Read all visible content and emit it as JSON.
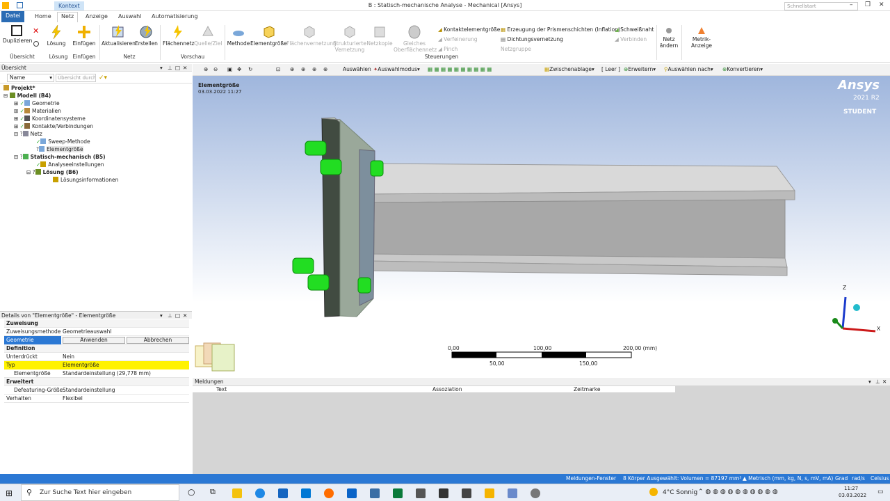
{
  "title_bar": {
    "context_tab": "Kontext",
    "window_title": "B : Statisch-mechanische Analyse - Mechanical [Ansys]",
    "search_placeholder": "Schnellstart",
    "minimize": "–",
    "restore": "❐",
    "close": "✕"
  },
  "ribbon_tabs": {
    "file": "Datei",
    "home": "Home",
    "mesh": "Netz",
    "display": "Anzeige",
    "selection": "Auswahl",
    "automation": "Automatisierung"
  },
  "ribbon": {
    "duplicate": "Duplizieren",
    "solve": "Lösung",
    "insert": "Einfügen",
    "update": "Aktualisieren",
    "create": "Erstellen",
    "surface_mesh": "Flächennetz",
    "source_target": "Quelle/Ziel",
    "method": "Methode",
    "element_size": "Elementgröße",
    "face_meshing": "Flächenvernetzung",
    "structured_meshing_1": "Strukturierte",
    "structured_meshing_2": "Vernetzung",
    "mesh_copy": "Netzkopie",
    "uniform_surface_1": "Gleiches",
    "uniform_surface_2": "Oberflächennetz",
    "contact_sizing": "Kontaktelementgröße",
    "refinement": "Verfeinerung",
    "pinch": "Pinch",
    "inflation": "Erzeugung der Prismenschichten (Inflation)",
    "gasket_mesh": "Dichtungsvernetzung",
    "mesh_group": "Netzgruppe",
    "weld": "Schweißnaht",
    "connect": "Verbinden",
    "mesh_change_1": "Netz",
    "mesh_change_2": "ändern",
    "metric_display": "Metrik-Anzeige",
    "group_overview": "Übersicht",
    "group_solve": "Lösung",
    "group_insert": "Einfügen",
    "group_mesh": "Netz",
    "group_preview": "Vorschau",
    "group_controls": "Steuerungen"
  },
  "outline": {
    "header": "Übersicht",
    "name_label": "Name",
    "search_placeholder": "Übersicht durch",
    "items": [
      {
        "label": "Projekt*",
        "bold": true
      },
      {
        "label": "Modell (B4)",
        "bold": true
      },
      {
        "label": "Geometrie"
      },
      {
        "label": "Materialien"
      },
      {
        "label": "Koordinatensysteme"
      },
      {
        "label": "Kontakte/Verbindungen"
      },
      {
        "label": "Netz"
      },
      {
        "label": "Sweep-Methode"
      },
      {
        "label": "Elementgröße"
      },
      {
        "label": "Statisch-mechanisch (B5)",
        "bold": true
      },
      {
        "label": "Analyseeinstellungen"
      },
      {
        "label": "Lösung (B6)",
        "bold": true
      },
      {
        "label": "Lösungsinformationen"
      }
    ]
  },
  "details": {
    "header": "Details von \"Elementgröße\" - Elementgröße",
    "sec_scope": "Zuweisung",
    "scope_method_k": "Zuweisungsmethode",
    "scope_method_v": "Geometrieauswahl",
    "geometry_k": "Geometrie",
    "apply": "Anwenden",
    "cancel": "Abbrechen",
    "sec_definition": "Definition",
    "suppressed_k": "Unterdrückt",
    "suppressed_v": "Nein",
    "type_k": "Typ",
    "type_v": "Elementgröße",
    "elsize_k": "Elementgröße",
    "elsize_v": "Standardeinstellung (29,778 mm)",
    "sec_advanced": "Erweitert",
    "defeature_k": "Defeaturing-Größe",
    "defeature_v": "Standardeinstellung",
    "behavior_k": "Verhalten",
    "behavior_v": "Flexibel"
  },
  "viewtoolbar": {
    "select": "Auswählen",
    "select_mode": "Auswahlmodus",
    "clipboard": "Zwischenablage",
    "empty": "[ Leer ]",
    "extend": "Erweitern",
    "select_by": "Auswählen nach",
    "convert": "Konvertieren"
  },
  "viewport": {
    "annotation_title": "Elementgröße",
    "annotation_date": "03.03.2022 11:27",
    "brand": "Ansys",
    "version": "2021 R2",
    "edition": "STUDENT",
    "scale_labels_top": [
      "0,00",
      "100,00",
      "200,00 (mm)"
    ],
    "scale_labels_bottom": [
      "50,00",
      "150,00"
    ],
    "axis_z": "Z",
    "axis_x": "X"
  },
  "messages": {
    "header": "Meldungen",
    "col_text": "Text",
    "col_assoc": "Assoziation",
    "col_time": "Zeitmarke"
  },
  "status_bar": {
    "messages_window": "Meldungen-Fenster",
    "selection": "8 Körper Ausgewählt: Volumen = 87197 mm³",
    "units": "Metrisch (mm, kg, N, s, mV, mA)",
    "angle": "Grad",
    "rot": "rad/s",
    "temp": "Celsius"
  },
  "taskbar": {
    "search": "Zur Suche Text hier eingeben",
    "weather": "4°C Sonnig",
    "time": "11:27",
    "date": "03.03.2022"
  },
  "colors": {
    "accent": "#2b78d4",
    "highlight": "#fff200",
    "bolt": "#22dd22"
  }
}
